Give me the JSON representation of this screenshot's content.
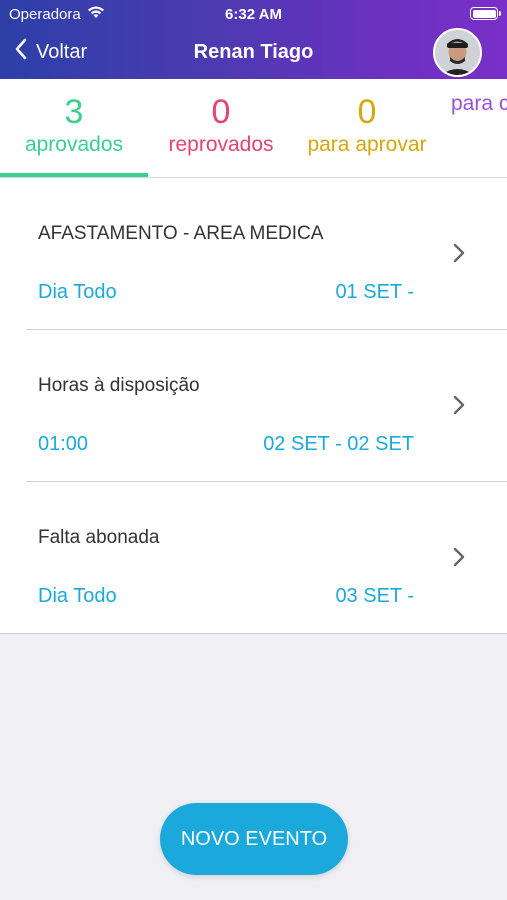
{
  "status_bar": {
    "carrier": "Operadora",
    "time": "6:32 AM"
  },
  "nav": {
    "back_label": "Voltar",
    "title": "Renan Tiago"
  },
  "tabs": [
    {
      "count": "3",
      "label": "aprovados",
      "color": "#3ccf8e",
      "selected": true
    },
    {
      "count": "0",
      "label": "reprovados",
      "color": "#e8436e"
    },
    {
      "count": "0",
      "label": "para aprovar",
      "color": "#d4a70e"
    },
    {
      "count": "",
      "label": "para c",
      "color": "#9b4fd6"
    }
  ],
  "events": [
    {
      "title": "AFASTAMENTO - AREA MEDICA",
      "left": "Dia Todo",
      "right": "01 SET -"
    },
    {
      "title": "Horas à disposição",
      "left": "01:00",
      "right": "02 SET - 02 SET"
    },
    {
      "title": "Falta abonada",
      "left": "Dia Todo",
      "right": "03 SET -"
    }
  ],
  "fab": {
    "label": "NOVO EVENTO"
  },
  "colors": {
    "accent": "#1ba9dc",
    "header_start": "#2d3fa8",
    "header_end": "#7a2fc8"
  }
}
